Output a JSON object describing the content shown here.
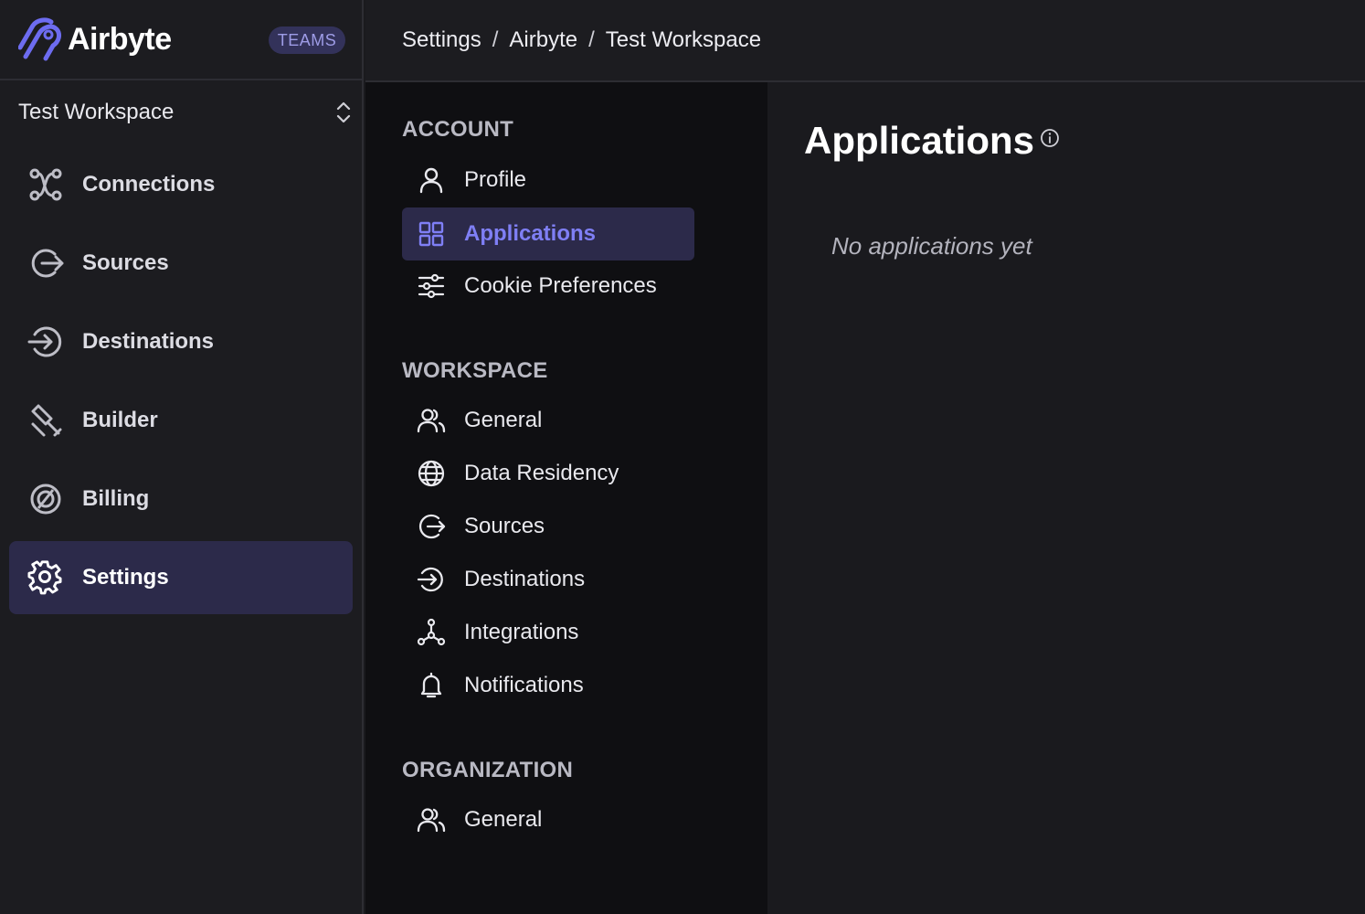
{
  "brand": {
    "name": "Airbyte",
    "badge": "TEAMS"
  },
  "workspace": {
    "selected": "Test Workspace"
  },
  "sidebar": {
    "items": [
      {
        "label": "Connections",
        "icon": "connections-icon"
      },
      {
        "label": "Sources",
        "icon": "sources-icon"
      },
      {
        "label": "Destinations",
        "icon": "destinations-icon"
      },
      {
        "label": "Builder",
        "icon": "builder-icon"
      },
      {
        "label": "Billing",
        "icon": "billing-icon"
      },
      {
        "label": "Settings",
        "icon": "gear-icon",
        "active": true
      }
    ]
  },
  "breadcrumb": {
    "items": [
      "Settings",
      "Airbyte",
      "Test Workspace"
    ],
    "separator": "/"
  },
  "settings_nav": {
    "account": {
      "title": "ACCOUNT",
      "items": [
        {
          "label": "Profile",
          "icon": "user-icon"
        },
        {
          "label": "Applications",
          "icon": "grid-icon",
          "active": true
        },
        {
          "label": "Cookie Preferences",
          "icon": "sliders-icon"
        }
      ]
    },
    "workspace": {
      "title": "WORKSPACE",
      "items": [
        {
          "label": "General",
          "icon": "users-icon"
        },
        {
          "label": "Data Residency",
          "icon": "globe-icon"
        },
        {
          "label": "Sources",
          "icon": "sources-icon"
        },
        {
          "label": "Destinations",
          "icon": "destinations-icon"
        },
        {
          "label": "Integrations",
          "icon": "integrations-icon"
        },
        {
          "label": "Notifications",
          "icon": "bell-icon"
        }
      ]
    },
    "organization": {
      "title": "ORGANIZATION",
      "items": [
        {
          "label": "General",
          "icon": "users-icon"
        }
      ]
    }
  },
  "main": {
    "title": "Applications",
    "empty_text": "No applications yet"
  },
  "colors": {
    "accent": "#7f7ff5",
    "active_bg": "#2c2a4a",
    "badge_bg": "#33325a"
  }
}
